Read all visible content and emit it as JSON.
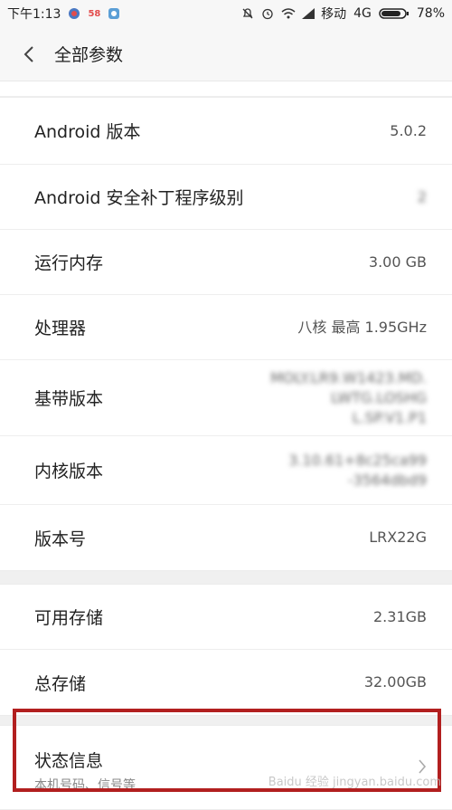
{
  "status_bar": {
    "time": "下午1:13",
    "badge_58": "58",
    "carrier": "移动",
    "network": "4G",
    "battery": "78%"
  },
  "header": {
    "title": "全部参数"
  },
  "rows": [
    {
      "label": "Android 版本",
      "value": "5.0.2"
    },
    {
      "label": "Android 安全补丁程序级别",
      "value": "2"
    },
    {
      "label": "运行内存",
      "value": "3.00 GB"
    },
    {
      "label": "处理器",
      "value": "八核 最高 1.95GHz"
    },
    {
      "label": "基带版本",
      "value": "MOLY.LR9.W1423.MD.\nLWTG.LOSHG\nL.SP.V1.P1"
    },
    {
      "label": "内核版本",
      "value": "3.10.61+8c25ca99\n-3564dbd9"
    },
    {
      "label": "版本号",
      "value": "LRX22G"
    }
  ],
  "storage": [
    {
      "label": "可用存储",
      "value": "2.31GB"
    },
    {
      "label": "总存储",
      "value": "32.00GB"
    }
  ],
  "status_info": {
    "title": "状态信息",
    "subtitle": "本机号码、信号等"
  },
  "watermark": "Baidu 经验 jingyan.baidu.com",
  "colors": {
    "highlight": "#b21f1f"
  }
}
